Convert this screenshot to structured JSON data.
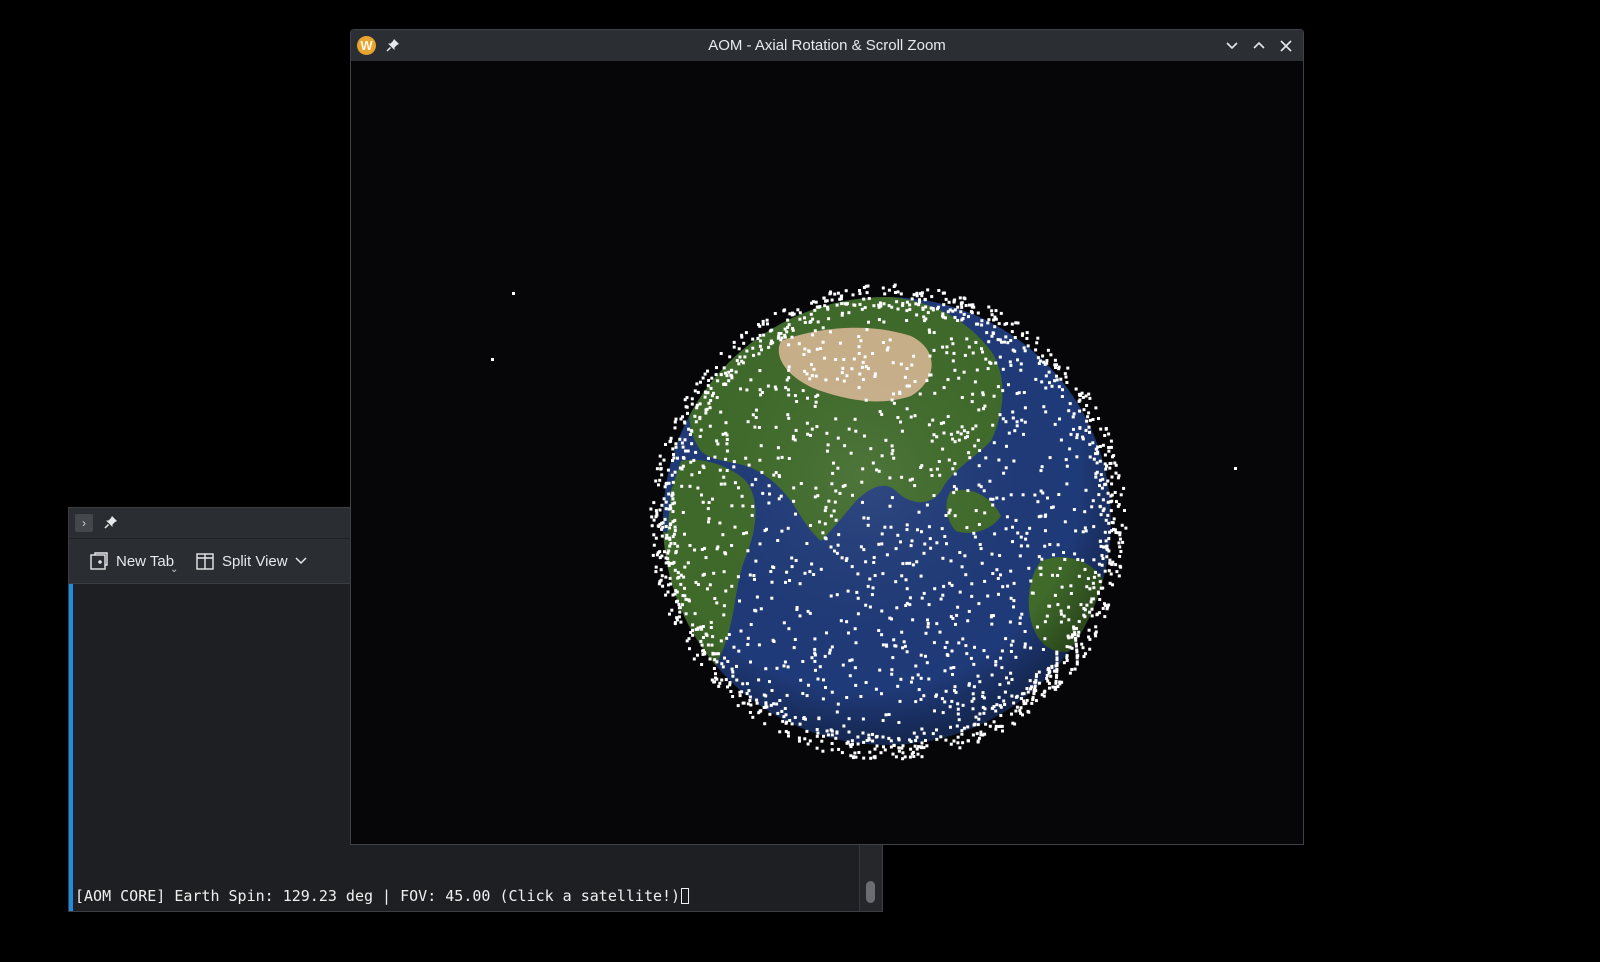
{
  "terminal": {
    "menu_icon": "chevron-right-icon",
    "pin_icon": "pin-icon",
    "toolbar": {
      "new_tab_label": "New Tab",
      "split_view_label": "Split View"
    },
    "output_line": "[AOM CORE] Earth Spin: 129.23 deg | FOV: 45.00 (Click a satellite!)"
  },
  "window": {
    "title": "AOM - Axial Rotation & Scroll Zoom",
    "app_icon_letter": "W",
    "controls": [
      "minimize-icon",
      "maximize-icon",
      "close-icon"
    ]
  },
  "scene": {
    "earth_spin_deg": 129.23,
    "fov": 45.0,
    "colors": {
      "ocean": "#1f3a78",
      "land_green": "#3f6a2a",
      "land_desert": "#c9b08a",
      "satellite": "#ffffff",
      "accent": "#1d8de2"
    }
  }
}
